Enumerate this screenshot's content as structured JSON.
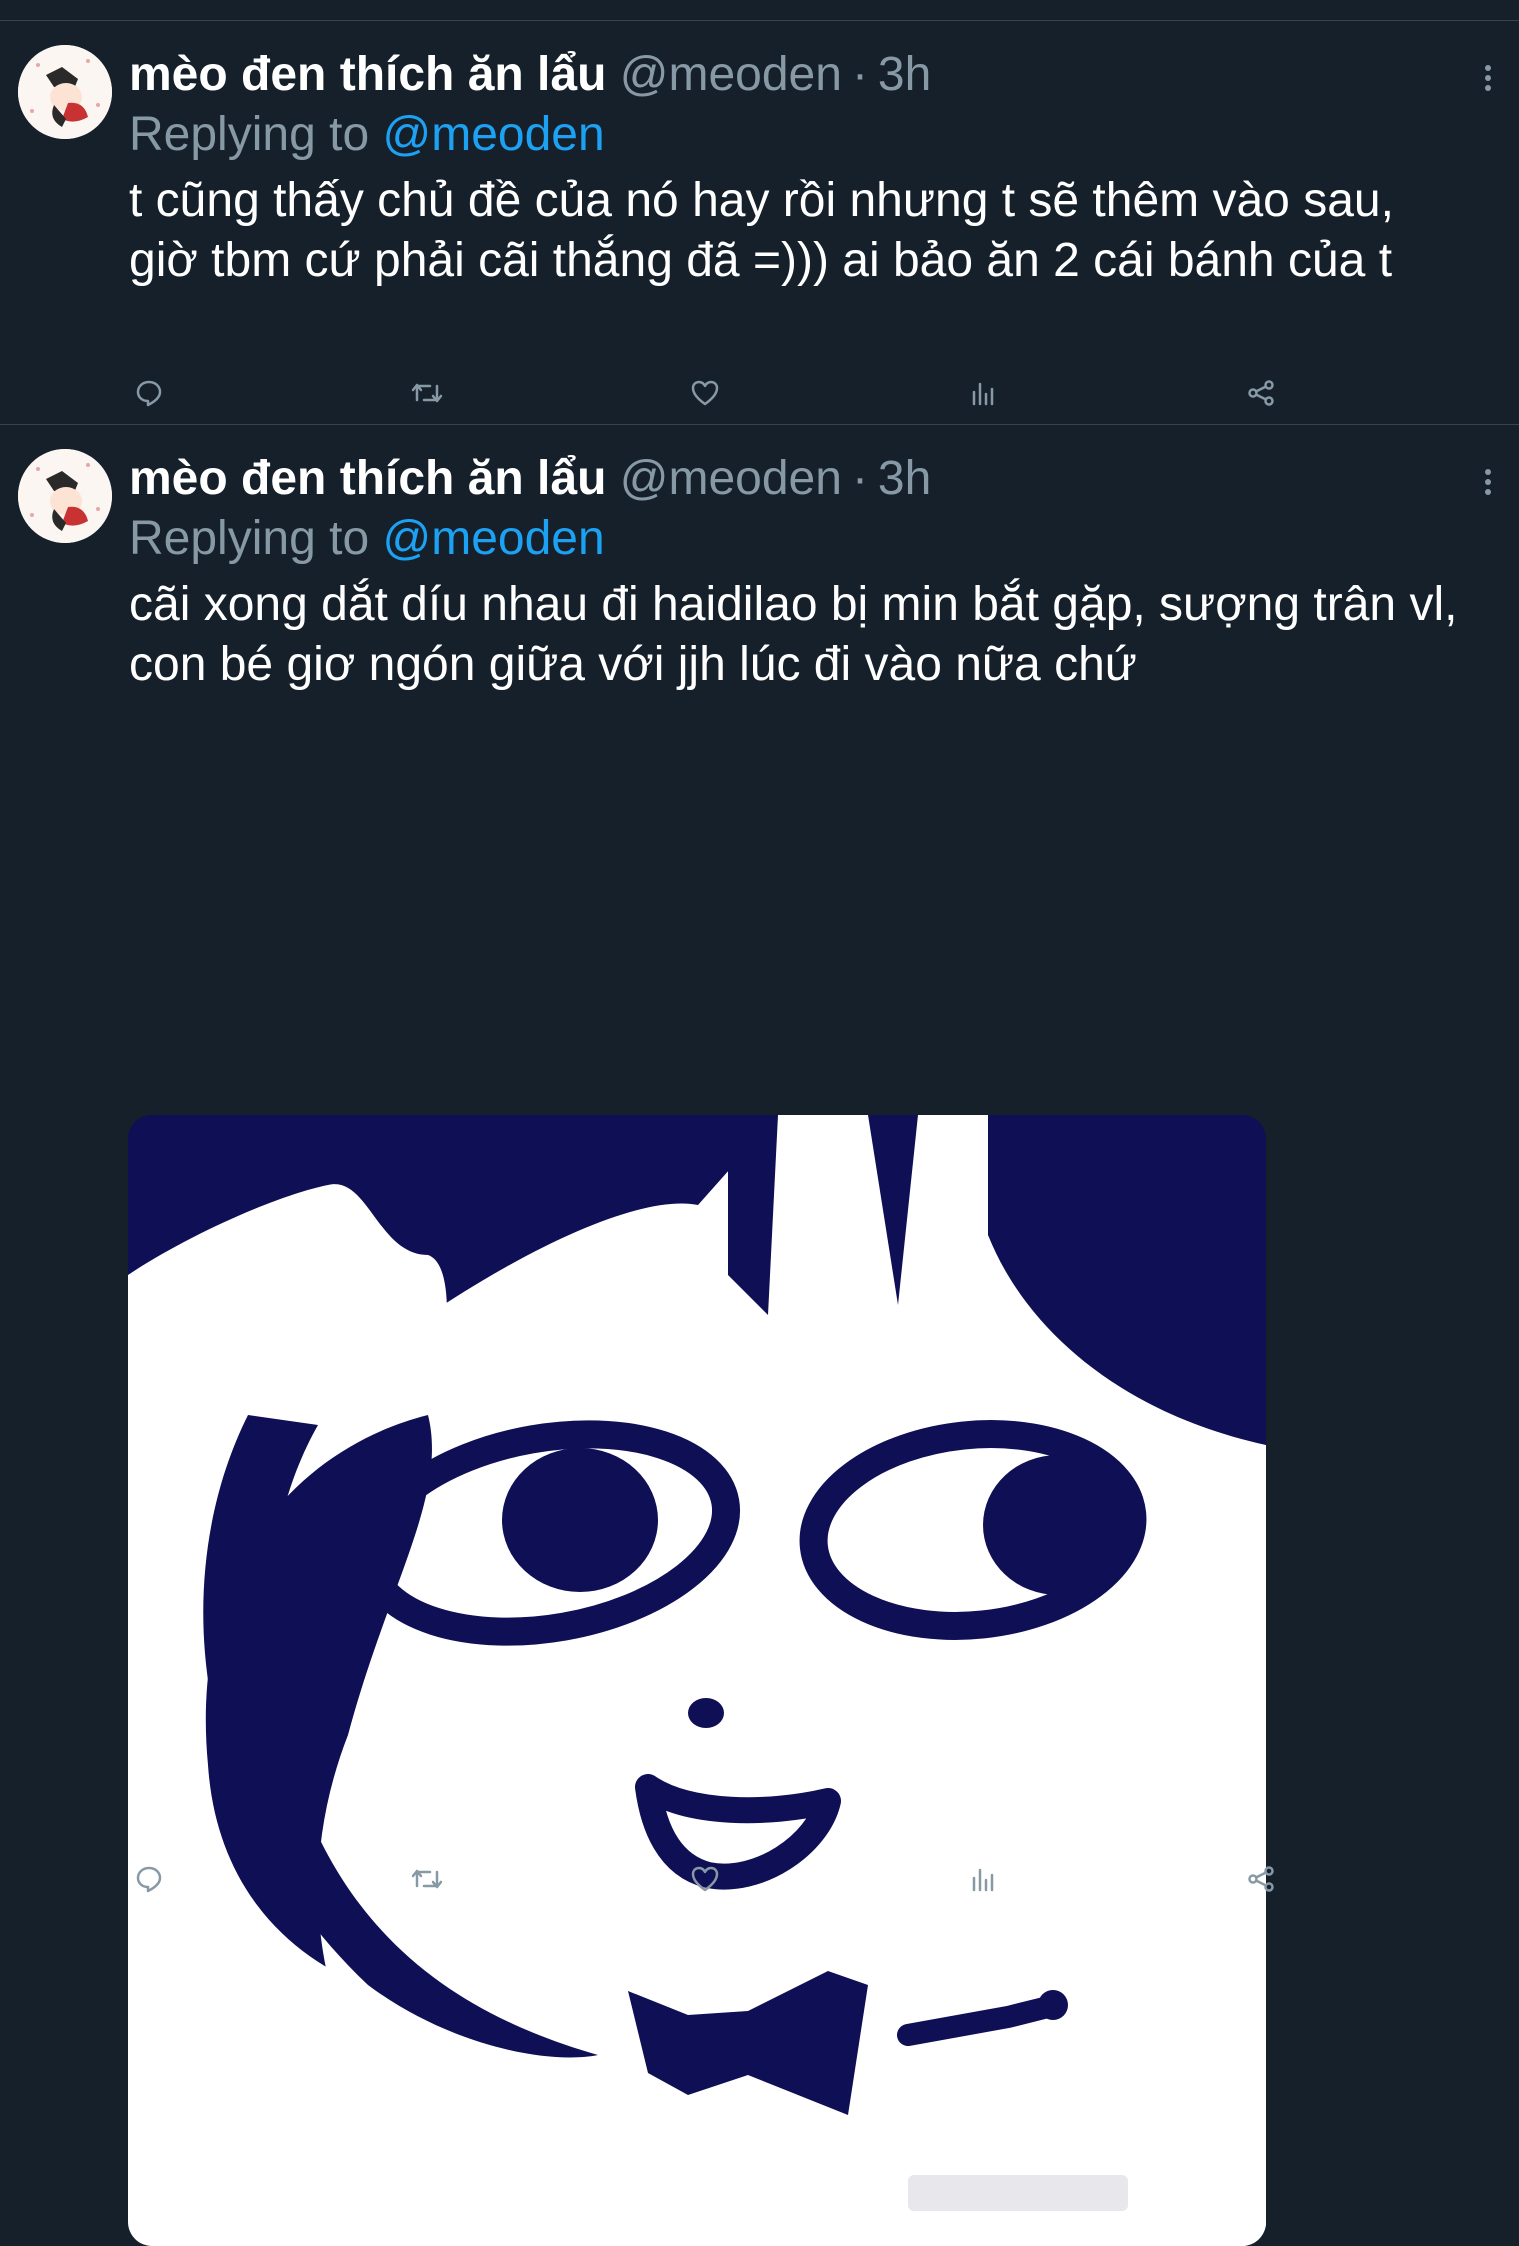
{
  "tweets": [
    {
      "display_name": "mèo đen thích ăn lẩu",
      "handle": "@meoden",
      "separator": "·",
      "time": "3h",
      "reply_prefix": "Replying to",
      "reply_handle": "@meoden",
      "text": "t cũng thấy chủ đề của nó hay rồi nhưng t sẽ thêm vào sau, giờ tbm cứ phải cãi thắng đã =))) ai bảo ăn 2 cái bánh của t",
      "actions": [
        "reply-icon",
        "retweet-icon",
        "like-icon",
        "stats-icon",
        "share-icon"
      ]
    },
    {
      "display_name": "mèo đen thích ăn lẩu",
      "handle": "@meoden",
      "separator": "·",
      "time": "3h",
      "reply_prefix": "Replying to",
      "reply_handle": "@meoden",
      "text": "cãi xong dắt díu nhau đi haidilao bị min bắt gặp, sượng trân vl, con bé giơ ngón giữa với jjh lúc đi vào nữa chứ",
      "media": "cartoon-cat-meme-image",
      "actions": [
        "reply-icon",
        "retweet-icon",
        "like-icon",
        "stats-icon",
        "share-icon"
      ]
    }
  ],
  "colors": {
    "background": "#15202b",
    "divider": "#38444d",
    "secondary_text": "#8899a6",
    "accent": "#1da1f2",
    "meme_navy": "#0f0f55"
  }
}
